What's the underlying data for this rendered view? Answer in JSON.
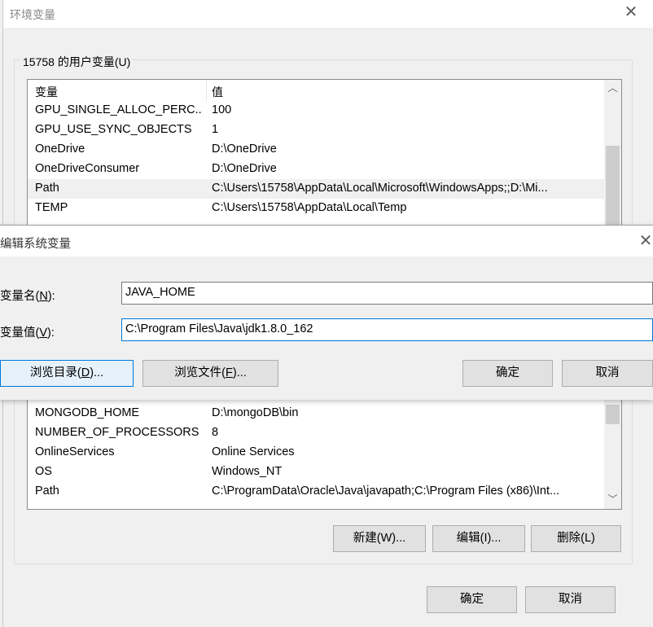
{
  "env_dialog": {
    "title": "环境变量",
    "user_group_title": "15758 的用户变量(U)",
    "user_list": {
      "col_name": "变量",
      "col_value": "值",
      "rows": [
        {
          "name": "GPU_SINGLE_ALLOC_PERC...",
          "value": "100"
        },
        {
          "name": "GPU_USE_SYNC_OBJECTS",
          "value": "1"
        },
        {
          "name": "OneDrive",
          "value": "D:\\OneDrive"
        },
        {
          "name": "OneDriveConsumer",
          "value": "D:\\OneDrive"
        },
        {
          "name": "Path",
          "value": "C:\\Users\\15758\\AppData\\Local\\Microsoft\\WindowsApps;;D:\\Mi..."
        },
        {
          "name": "TEMP",
          "value": "C:\\Users\\15758\\AppData\\Local\\Temp"
        }
      ],
      "selected_row": 4
    },
    "system_list": {
      "rows": [
        {
          "name": "MONGODB_HOME",
          "value": "D:\\mongoDB\\bin"
        },
        {
          "name": "NUMBER_OF_PROCESSORS",
          "value": "8"
        },
        {
          "name": "OnlineServices",
          "value": "Online Services"
        },
        {
          "name": "OS",
          "value": "Windows_NT"
        },
        {
          "name": "Path",
          "value": "C:\\ProgramData\\Oracle\\Java\\javapath;C:\\Program Files (x86)\\Int..."
        }
      ]
    },
    "buttons": {
      "new": "新建(W)...",
      "edit": "编辑(I)...",
      "delete": "删除(L)",
      "ok": "确定",
      "cancel": "取消"
    }
  },
  "edit_dialog": {
    "title": "编辑系统变量",
    "name_label_pre": "变量名(",
    "name_label_key": "N",
    "name_label_post": "):",
    "value_label_pre": "变量值(",
    "value_label_key": "V",
    "value_label_post": "):",
    "name_value": "JAVA_HOME",
    "value_value": "C:\\Program Files\\Java\\jdk1.8.0_162",
    "buttons": {
      "browse_dir_pre": "浏览目录(",
      "browse_dir_key": "D",
      "browse_dir_post": ")...",
      "browse_file_pre": "浏览文件(",
      "browse_file_key": "F",
      "browse_file_post": ")...",
      "ok": "确定",
      "cancel": "取消"
    }
  },
  "icons": {
    "close": "close-icon",
    "scroll_up": "chevron-up-icon",
    "scroll_down": "chevron-down-icon"
  }
}
